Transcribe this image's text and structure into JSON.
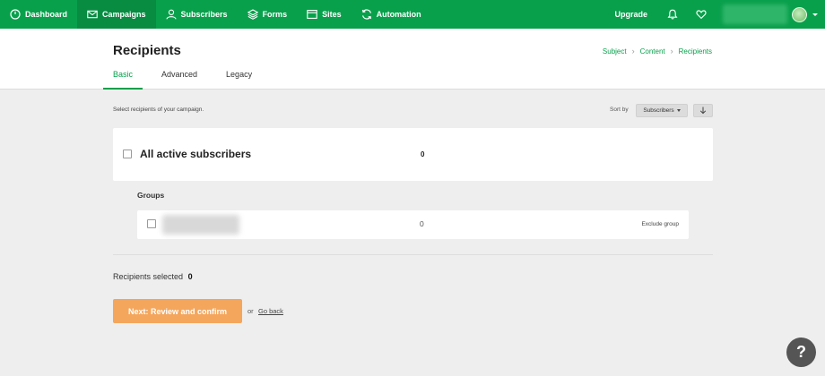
{
  "nav": {
    "items": [
      {
        "label": "Dashboard",
        "icon": "dashboard-icon"
      },
      {
        "label": "Campaigns",
        "icon": "mail-icon",
        "active": true
      },
      {
        "label": "Subscribers",
        "icon": "user-icon"
      },
      {
        "label": "Forms",
        "icon": "layers-icon"
      },
      {
        "label": "Sites",
        "icon": "browser-icon"
      },
      {
        "label": "Automation",
        "icon": "sync-icon"
      }
    ],
    "upgrade": "Upgrade",
    "bell_icon": "bell-icon",
    "heart_icon": "heart-icon"
  },
  "header": {
    "title": "Recipients",
    "breadcrumb": [
      "Subject",
      "Content",
      "Recipients"
    ],
    "tabs": [
      "Basic",
      "Advanced",
      "Legacy"
    ],
    "active_tab": "Basic"
  },
  "body": {
    "description": "Select recipients of your campaign.",
    "sort_label": "Sort by",
    "sort_value": "Subscribers",
    "all_label": "All active subscribers",
    "all_count": "0",
    "groups_label": "Groups",
    "group_count": "0",
    "exclude_label": "Exclude group",
    "selected_label": "Recipients selected",
    "selected_count": "0",
    "next_button": "Next: Review and confirm",
    "or_text": "or",
    "go_back": "Go back",
    "help": "?"
  },
  "colors": {
    "brand_green": "#09a04c",
    "next_button": "#f4a65d"
  }
}
